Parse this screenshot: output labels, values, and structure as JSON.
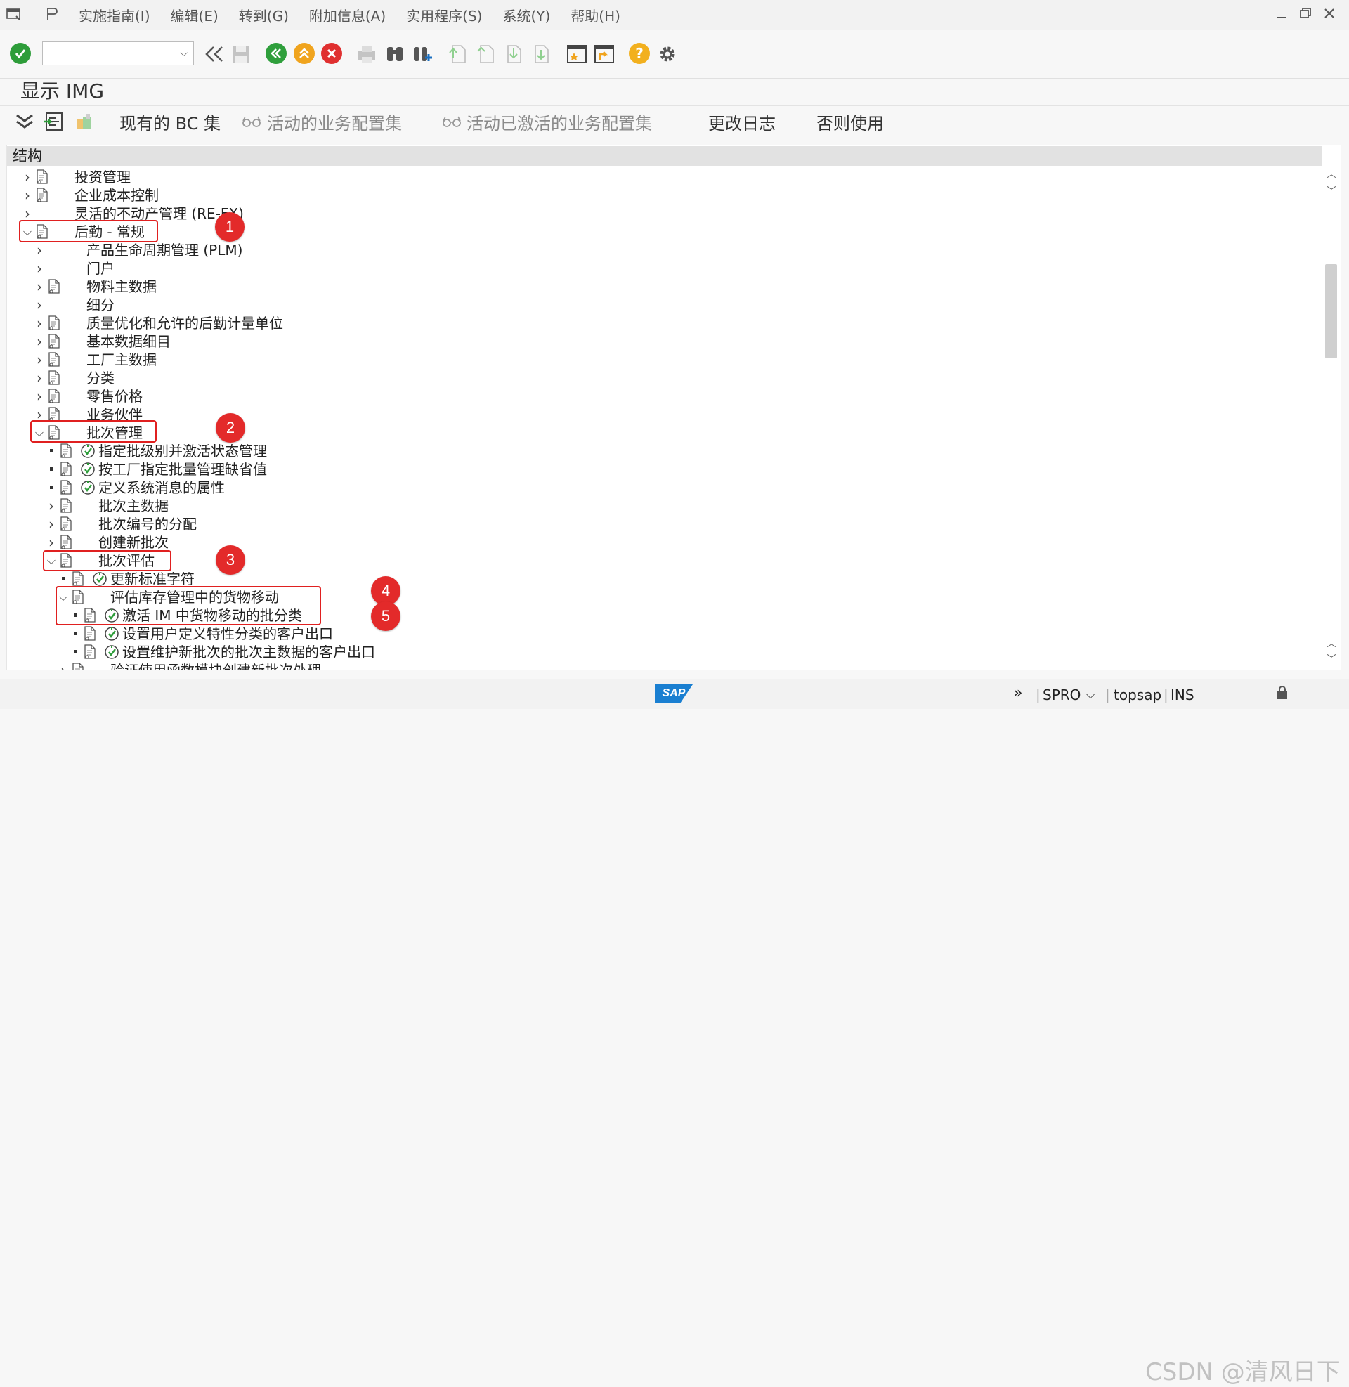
{
  "menubar": {
    "items": [
      "实施指南(I)",
      "编辑(E)",
      "转到(G)",
      "附加信息(A)",
      "实用程序(S)",
      "系统(Y)",
      "帮助(H)"
    ]
  },
  "toolbar": {
    "command_field_value": "",
    "icons": [
      "enter-icon",
      "back-double-icon",
      "save-icon",
      "back-icon",
      "exit-icon",
      "cancel-icon",
      "print-icon",
      "find-icon",
      "find-next-icon",
      "first-page-icon",
      "previous-page-icon",
      "next-page-icon",
      "last-page-icon",
      "create-session-icon",
      "shortcut-icon",
      "help-icon",
      "settings-icon"
    ]
  },
  "page": {
    "title": "显示 IMG"
  },
  "app_toolbar": {
    "existing_bc_sets": "现有的 BC 集",
    "active_bc_sets": "活动的业务配置集",
    "activated_bc_sets": "活动已激活的业务配置集",
    "change_log": "更改日志",
    "where_used": "否则使用"
  },
  "tree": {
    "header": "结构",
    "rows": [
      {
        "label": "投资管理",
        "level": 0,
        "state": "collapsed",
        "doc": true,
        "activity": false
      },
      {
        "label": "企业成本控制",
        "level": 0,
        "state": "collapsed",
        "doc": true,
        "activity": false
      },
      {
        "label": "灵活的不动产管理 (RE-FX)",
        "level": 0,
        "state": "collapsed",
        "doc": false,
        "activity": false
      },
      {
        "label": "后勤 - 常规",
        "level": 0,
        "state": "expanded",
        "doc": true,
        "activity": false
      },
      {
        "label": "产品生命周期管理 (PLM)",
        "level": 1,
        "state": "collapsed",
        "doc": false,
        "activity": false
      },
      {
        "label": "门户",
        "level": 1,
        "state": "collapsed",
        "doc": false,
        "activity": false
      },
      {
        "label": "物料主数据",
        "level": 1,
        "state": "collapsed",
        "doc": true,
        "activity": false
      },
      {
        "label": "细分",
        "level": 1,
        "state": "collapsed",
        "doc": false,
        "activity": false
      },
      {
        "label": "质量优化和允许的后勤计量单位",
        "level": 1,
        "state": "collapsed",
        "doc": true,
        "activity": false
      },
      {
        "label": "基本数据细目",
        "level": 1,
        "state": "collapsed",
        "doc": true,
        "activity": false
      },
      {
        "label": "工厂主数据",
        "level": 1,
        "state": "collapsed",
        "doc": true,
        "activity": false
      },
      {
        "label": "分类",
        "level": 1,
        "state": "collapsed",
        "doc": true,
        "activity": false
      },
      {
        "label": "零售价格",
        "level": 1,
        "state": "collapsed",
        "doc": true,
        "activity": false
      },
      {
        "label": "业务伙伴",
        "level": 1,
        "state": "collapsed",
        "doc": true,
        "activity": false
      },
      {
        "label": "批次管理",
        "level": 1,
        "state": "expanded",
        "doc": true,
        "activity": false
      },
      {
        "label": "指定批级别并激活状态管理",
        "level": 2,
        "state": "leaf",
        "doc": true,
        "activity": true
      },
      {
        "label": "按工厂指定批量管理缺省值",
        "level": 2,
        "state": "leaf",
        "doc": true,
        "activity": true
      },
      {
        "label": "定义系统消息的属性",
        "level": 2,
        "state": "leaf",
        "doc": true,
        "activity": true
      },
      {
        "label": "批次主数据",
        "level": 2,
        "state": "collapsed",
        "doc": true,
        "activity": false
      },
      {
        "label": "批次编号的分配",
        "level": 2,
        "state": "collapsed",
        "doc": true,
        "activity": false
      },
      {
        "label": "创建新批次",
        "level": 2,
        "state": "collapsed",
        "doc": true,
        "activity": false
      },
      {
        "label": "批次评估",
        "level": 2,
        "state": "expanded",
        "doc": true,
        "activity": false
      },
      {
        "label": "更新标准字符",
        "level": 3,
        "state": "leaf",
        "doc": true,
        "activity": true
      },
      {
        "label": "评估库存管理中的货物移动",
        "level": 3,
        "state": "expanded",
        "doc": true,
        "activity": false
      },
      {
        "label": "激活 IM 中货物移动的批分类",
        "level": 4,
        "state": "leaf",
        "doc": true,
        "activity": true
      },
      {
        "label": "设置用户定义特性分类的客户出口",
        "level": 4,
        "state": "leaf",
        "doc": true,
        "activity": true
      },
      {
        "label": "设置维护新批次的批次主数据的客户出口",
        "level": 4,
        "state": "leaf",
        "doc": true,
        "activity": true
      },
      {
        "label": "验证使用函数模块创建新批次处理",
        "level": 3,
        "state": "collapsed",
        "doc": true,
        "activity": false
      }
    ]
  },
  "annotations": [
    "1",
    "2",
    "3",
    "4",
    "5"
  ],
  "statusbar": {
    "logo": "SAP",
    "transaction": "SPRO",
    "server": "topsap",
    "mode": "INS",
    "watermark": "CSDN @清风日下"
  },
  "colors": {
    "enter_green": "#2e9d3a",
    "back_green": "#2f9f3c",
    "exit_orange": "#f0a41e",
    "cancel_red": "#e03030",
    "help_yellow": "#f2b01e",
    "annotation_red": "#e32a2a",
    "sap_blue": "#1a7fd1"
  }
}
